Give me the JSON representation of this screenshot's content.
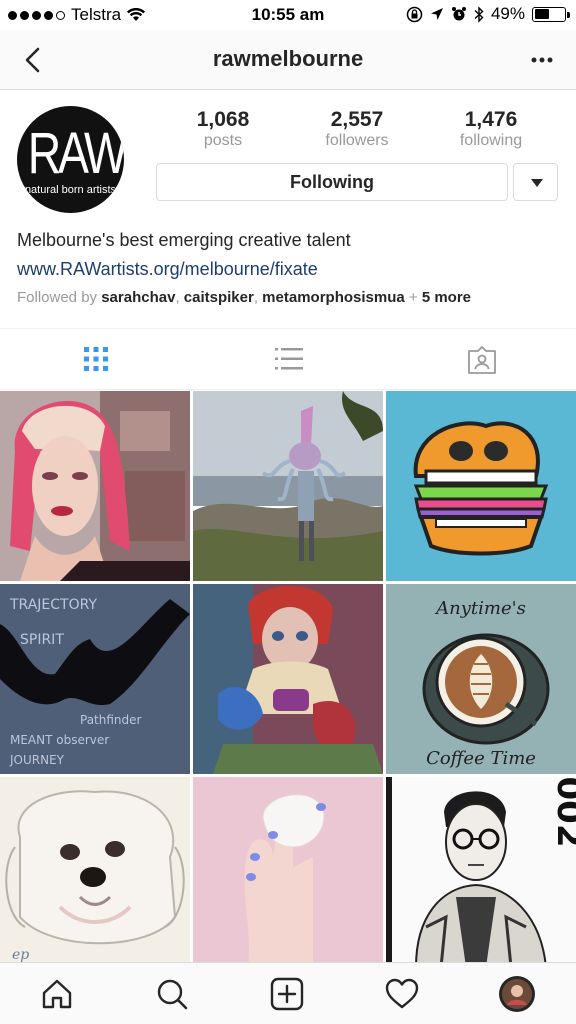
{
  "status_bar": {
    "carrier": "Telstra",
    "time": "10:55 am",
    "battery": "49%",
    "battery_level": 0.49
  },
  "nav": {
    "title": "rawmelbourne"
  },
  "profile": {
    "avatar_text": "RAW",
    "avatar_tagline": "natural born artists",
    "stats": [
      {
        "value": "1,068",
        "label": "posts"
      },
      {
        "value": "2,557",
        "label": "followers"
      },
      {
        "value": "1,476",
        "label": "following"
      }
    ],
    "follow_button": "Following",
    "bio": "Melbourne's best emerging creative talent",
    "link": "www.RAWartists.org/melbourne/fixate",
    "followed_by": {
      "prefix": "Followed by ",
      "users": [
        "sarahchav",
        "caitspiker",
        "metamorphosismua"
      ],
      "more": "5 more"
    }
  },
  "grid": {
    "tiles": [
      {
        "name": "portrait-pink-hair"
      },
      {
        "name": "squid-sculpture-beach"
      },
      {
        "name": "burger-illustration"
      },
      {
        "name": "trajectory-spirit-art"
      },
      {
        "name": "doll-painting"
      },
      {
        "name": "coffee-time-illustration",
        "title": "Anytime's",
        "caption": "Coffee Time"
      },
      {
        "name": "dog-drawing"
      },
      {
        "name": "hand-holding-object"
      },
      {
        "name": "man-glasses-drawing",
        "side_text": "002"
      }
    ]
  },
  "colors": {
    "accent": "#3897f0",
    "link": "#1d3f6e",
    "muted": "#999999",
    "border": "#dbdbdb"
  }
}
